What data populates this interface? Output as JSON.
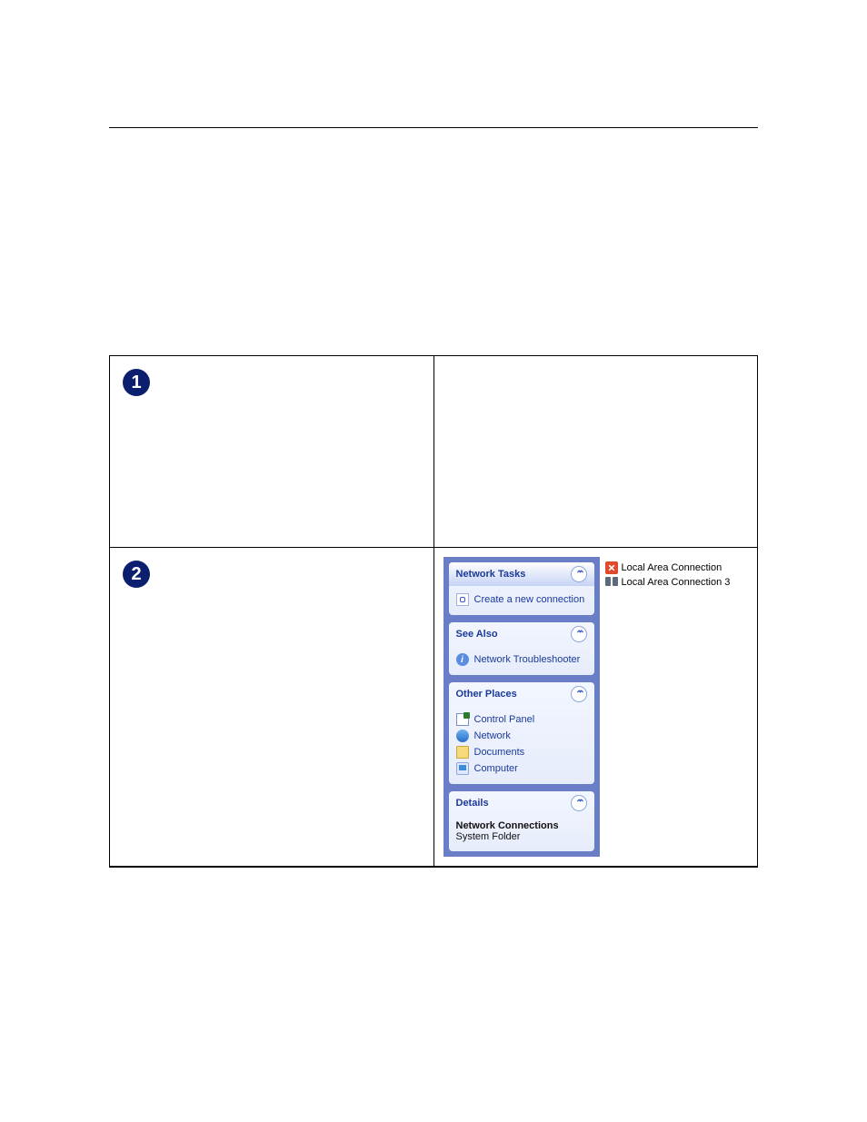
{
  "steps": {
    "one": "1",
    "two": "2"
  },
  "screenshot": {
    "panels": {
      "network_tasks": {
        "title": "Network Tasks",
        "items": [
          {
            "icon": "new-connection-icon",
            "label": "Create a new connection"
          }
        ]
      },
      "see_also": {
        "title": "See Also",
        "items": [
          {
            "icon": "info-icon",
            "label": "Network Troubleshooter"
          }
        ]
      },
      "other_places": {
        "title": "Other Places",
        "items": [
          {
            "icon": "control-panel-icon",
            "label": "Control Panel"
          },
          {
            "icon": "network-icon",
            "label": "Network"
          },
          {
            "icon": "documents-icon",
            "label": "Documents"
          },
          {
            "icon": "computer-icon",
            "label": "Computer"
          }
        ]
      },
      "details": {
        "title": "Details",
        "line1": "Network Connections",
        "line2": "System Folder"
      }
    },
    "connections": [
      {
        "icon": "lan-disconnected-icon",
        "label": "Local Area Connection"
      },
      {
        "icon": "lan-icon",
        "label": "Local Area Connection 3"
      }
    ]
  }
}
